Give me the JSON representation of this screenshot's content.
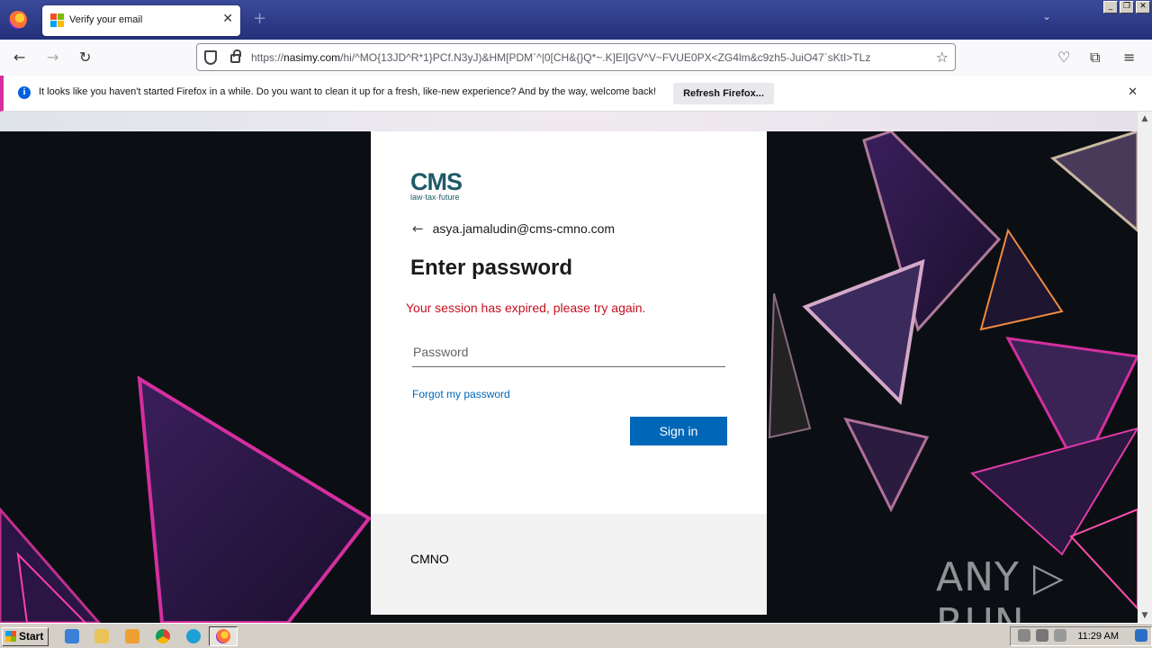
{
  "browser": {
    "tab_title": "Verify your email",
    "url_prefix": "https://",
    "url_domain": "nasimy.com",
    "url_rest": "/hi/^MO{13JD^R*1}PCf.N3yJ)&HM[PDM`^|0[CH&{}Q*~.K]El]GV^V~FVUE0PX<ZG4lm&c9zh5-JuiO47`sKtI>TLz",
    "notification_text": "It looks like you haven't started Firefox in a while. Do you want to clean it up for a fresh, like-new experience? And by the way, welcome back!",
    "notification_button": "Refresh Firefox..."
  },
  "login": {
    "logo_text": "CMS",
    "logo_tagline": "law·tax·future",
    "email": "asya.jamaludin@cms-cmno.com",
    "heading": "Enter password",
    "error": "Your session has expired, please try again.",
    "password_placeholder": "Password",
    "forgot_link": "Forgot my password",
    "signin_button": "Sign in",
    "footer_text": "CMNO"
  },
  "watermark": "ANY ▷ RUN",
  "taskbar": {
    "start_label": "Start",
    "clock": "11:29 AM"
  }
}
